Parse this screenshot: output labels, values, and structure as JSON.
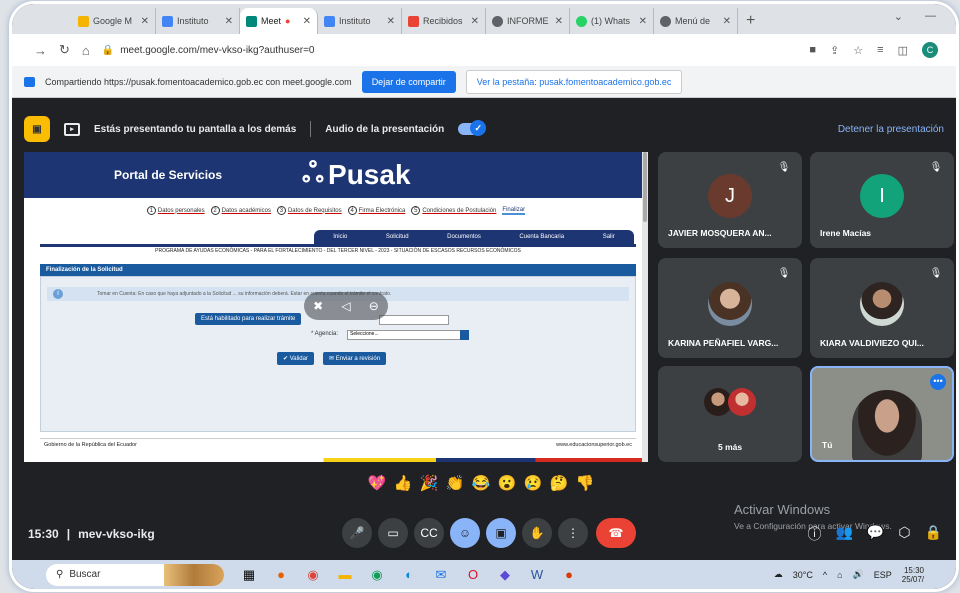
{
  "browser": {
    "tabs": [
      {
        "label": "Google M",
        "color": "#f4b400"
      },
      {
        "label": "Instituto",
        "color": "#4285f4"
      },
      {
        "label": "Meet",
        "color": "#00897b",
        "active": true
      },
      {
        "label": "Instituto",
        "color": "#4285f4"
      },
      {
        "label": "Recibidos",
        "color": "#ea4335"
      },
      {
        "label": "INFORME",
        "color": "#5f6368"
      },
      {
        "label": "(1) Whats",
        "color": "#25d366"
      },
      {
        "label": "Menú de",
        "color": "#5f6368"
      }
    ],
    "url": "meet.google.com/mev-vkso-ikg?authuser=0",
    "profile_initial": "C"
  },
  "sharebar": {
    "text": "Compartiendo https://pusak.fomentoacademico.gob.ec con meet.google.com",
    "stop_label": "Dejar de compartir",
    "see_label": "Ver la pestaña: pusak.fomentoacademico.gob.ec"
  },
  "presenting": {
    "text": "Estás presentando tu pantalla a los demás",
    "audio_label": "Audio de la presentación",
    "stop_label": "Detener la presentación"
  },
  "portal": {
    "title": "Portal de Servicios",
    "logo": "Pusak",
    "steps": [
      {
        "n": "1",
        "label": "Datos personales"
      },
      {
        "n": "2",
        "label": "Datos académicos"
      },
      {
        "n": "3",
        "label": "Datos de Requisitos"
      },
      {
        "n": "4",
        "label": "Firma Electrónica"
      },
      {
        "n": "5",
        "label": "Condiciones de Postulación"
      }
    ],
    "current_step": "Finalizar",
    "nav": [
      "Inicio",
      "Solicitud",
      "Documentos",
      "Cuenta Bancaria",
      "Salir"
    ],
    "program": "PROGRAMA DE AYUDAS ECONÓMICAS - PARA EL FORTALECIMIENTO - DEL TERCER NIVEL - 2023 - SITUACIÓN DE ESCASOS RECURSOS ECONÓMICOS",
    "section": "Finalización de la Solicitud",
    "info": "Tomar en Cuenta: En caso que haya adjuntado a la Solicitud ... su información deberá. Estar en cuenta cuando el trámite el contrato.",
    "button_validate_doc": "Está habilitado para realizar trámite",
    "agency_label": "* Agencia:",
    "agency_value": "Seleccione...",
    "btn_validar": "✔ Validar",
    "btn_enviar": "✉ Enviar a revisión",
    "footer_left": "Gobierno de la República del Ecuador",
    "footer_right": "www.educacionsuperior.gob.ec"
  },
  "participants": [
    {
      "name": "JAVIER MOSQUERA AN...",
      "initial": "J",
      "color": "#6b3a2e"
    },
    {
      "name": "Irene Macías",
      "initial": "I",
      "color": "#12a37b"
    },
    {
      "name": "KARINA PEÑAFIEL VARG..."
    },
    {
      "name": "KIARA VALDIVIEZO QUI..."
    },
    {
      "name": "5 más"
    },
    {
      "name": "Tú"
    }
  ],
  "reactions": [
    "💖",
    "👍",
    "🎉",
    "👏",
    "😂",
    "😮",
    "😢",
    "🤔",
    "👎"
  ],
  "meeting": {
    "time": "15:30",
    "code": "mev-vkso-ikg"
  },
  "activate": {
    "line1": "Activar Windows",
    "line2": "Ve a Configuración para activar Windows."
  },
  "taskbar": {
    "search_placeholder": "Buscar",
    "temperature": "30°C",
    "lang": "ESP",
    "clock_time": "15:30",
    "clock_date": "25/07/"
  }
}
